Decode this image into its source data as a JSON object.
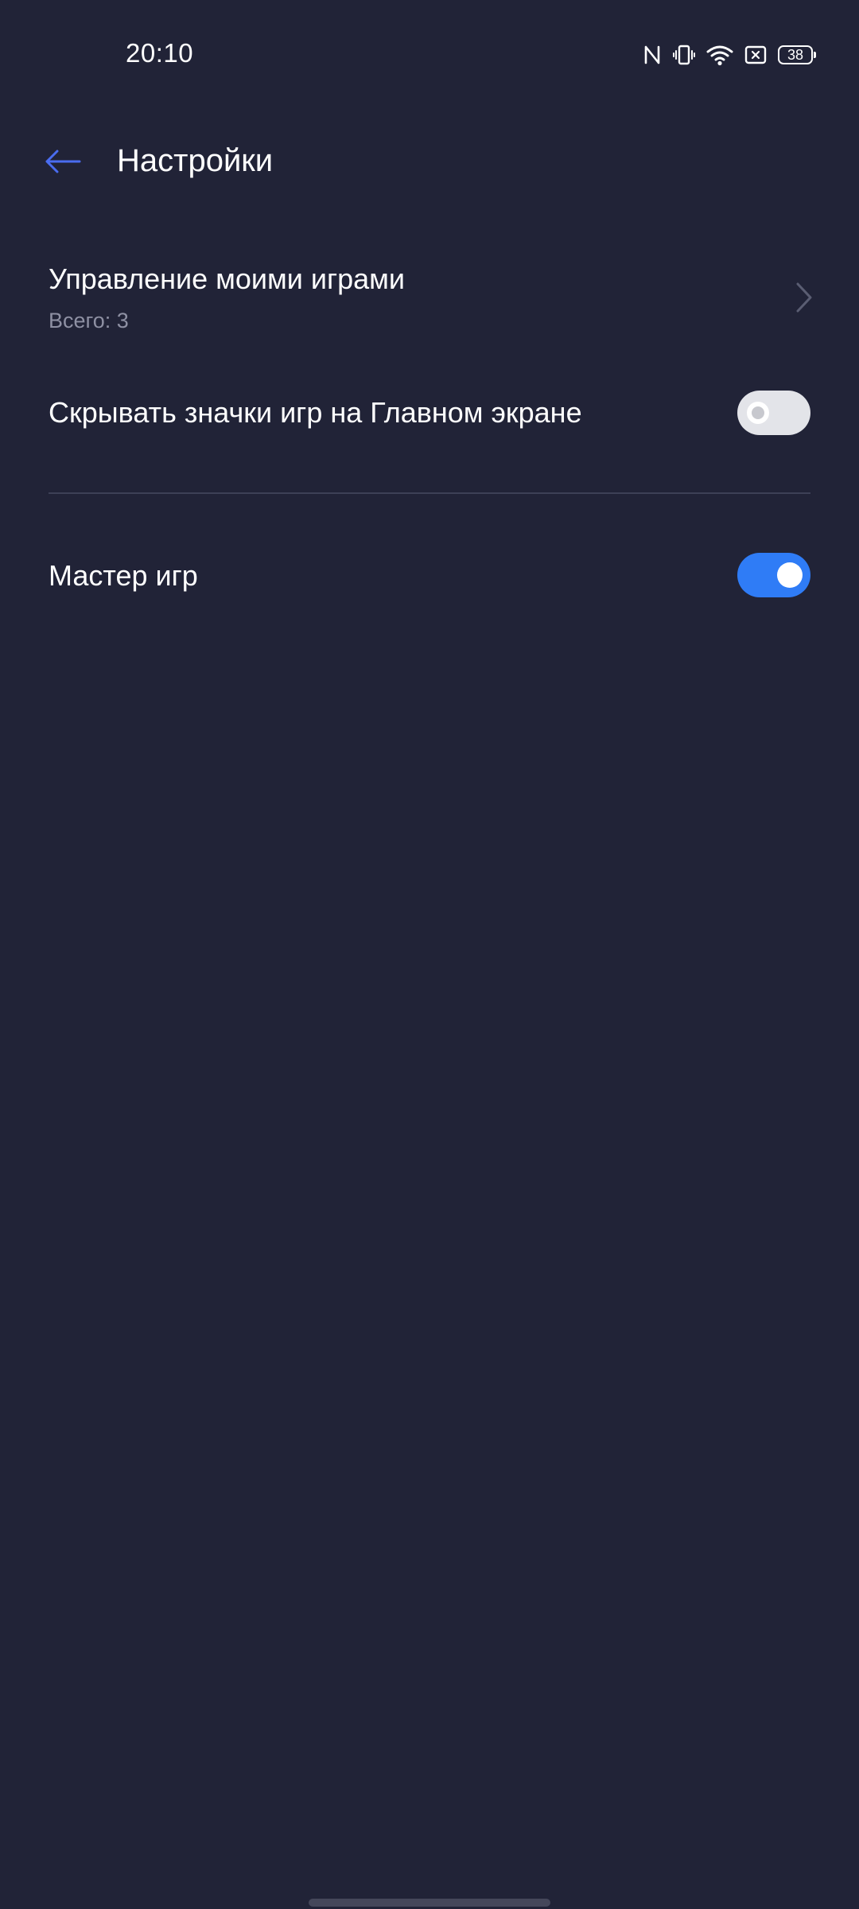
{
  "status_bar": {
    "time": "20:10",
    "battery_level": "38",
    "icons": [
      "nfc-icon",
      "vibrate-icon",
      "wifi-icon",
      "sim-absent-icon",
      "battery-icon"
    ]
  },
  "header": {
    "title": "Настройки",
    "back_icon": "arrow-left-icon"
  },
  "settings": {
    "manage_games": {
      "title": "Управление моими играми",
      "subtitle": "Всего: 3"
    },
    "hide_icons": {
      "title": "Скрывать значки игр на Главном экране",
      "enabled": false
    },
    "game_master": {
      "title": "Мастер игр",
      "enabled": true
    }
  },
  "colors": {
    "background": "#212337",
    "accent": "#2f7cf6",
    "back_arrow": "#4a6cf0",
    "secondary_text": "#8e90a3"
  }
}
